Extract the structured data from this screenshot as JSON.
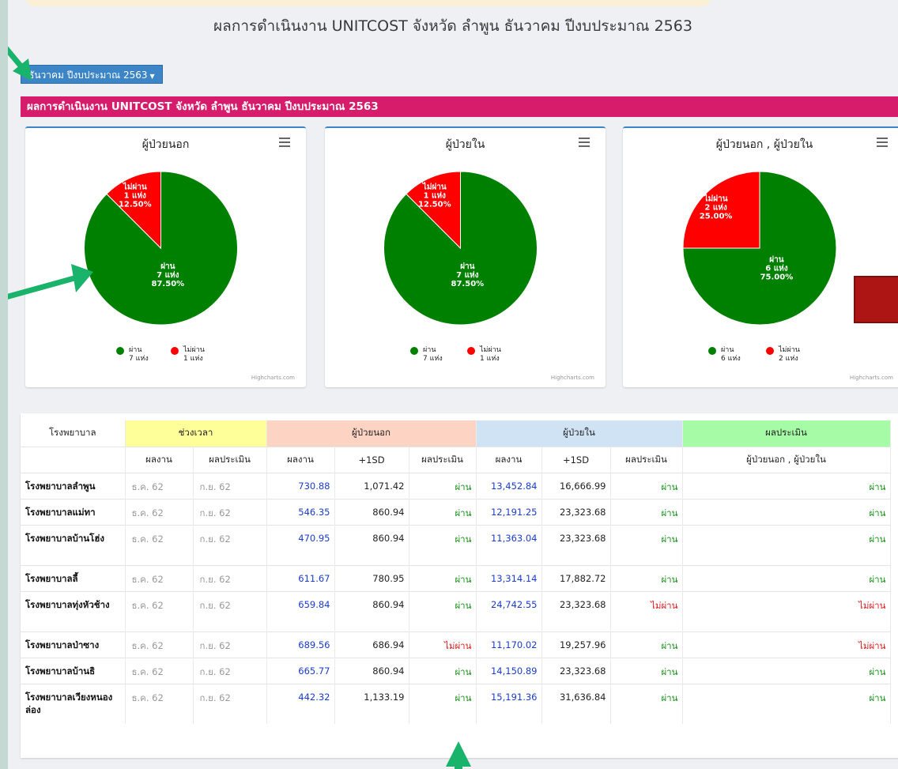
{
  "page": {
    "title": "ผลการดำเนินงาน UNITCOST จังหวัด ลำพูน ธันวาคม ปีงบประมาณ 2563",
    "period_button": "ธันวาคม ปีงบประมาณ 2563",
    "banner": "ผลการดำเนินงาน UNITCOST จังหวัด ลำพูน ธันวาคม ปีงบประมาณ 2563"
  },
  "colors": {
    "pass": "#008000",
    "fail": "#ff0000",
    "banner": "#d61c6b",
    "button": "#3c85c6",
    "arrow": "#19b36b"
  },
  "chart_data": [
    {
      "type": "pie",
      "title": "ผู้ป่วยนอก",
      "slices": [
        {
          "name": "ผ่าน",
          "value": 7,
          "percent": 87.5,
          "label_line1": "ผ่าน",
          "label_line2": "7 แห่ง",
          "label_line3": "87.50%",
          "legend_line2": "7 แห่ง"
        },
        {
          "name": "ไม่ผ่าน",
          "value": 1,
          "percent": 12.5,
          "label_line1": "ไม่ผ่าน",
          "label_line2": "1 แห่ง",
          "label_line3": "12.50%",
          "legend_line2": "1 แห่ง"
        }
      ],
      "credits": "Highcharts.com"
    },
    {
      "type": "pie",
      "title": "ผู้ป่วยใน",
      "slices": [
        {
          "name": "ผ่าน",
          "value": 7,
          "percent": 87.5,
          "label_line1": "ผ่าน",
          "label_line2": "7 แห่ง",
          "label_line3": "87.50%",
          "legend_line2": "7 แห่ง"
        },
        {
          "name": "ไม่ผ่าน",
          "value": 1,
          "percent": 12.5,
          "label_line1": "ไม่ผ่าน",
          "label_line2": "1 แห่ง",
          "label_line3": "12.50%",
          "legend_line2": "1 แห่ง"
        }
      ],
      "credits": "Highcharts.com"
    },
    {
      "type": "pie",
      "title": "ผู้ป่วยนอก , ผู้ป่วยใน",
      "slices": [
        {
          "name": "ผ่าน",
          "value": 6,
          "percent": 75.0,
          "label_line1": "ผ่าน",
          "label_line2": "6 แห่ง",
          "label_line3": "75.00%",
          "legend_line2": "6 แห่ง"
        },
        {
          "name": "ไม่ผ่าน",
          "value": 2,
          "percent": 25.0,
          "label_line1": "ไม่ผ่าน",
          "label_line2": "2 แห่ง",
          "label_line3": "25.00%",
          "legend_line2": "2 แห่ง"
        }
      ],
      "credits": "Highcharts.com"
    }
  ],
  "table": {
    "group_headers": {
      "hospital": "โรงพยาบาล",
      "period": "ช่วงเวลา",
      "opd": "ผู้ป่วยนอก",
      "ipd": "ผู้ป่วยใน",
      "eval": "ผลประเมิน"
    },
    "sub_headers": {
      "work": "ผลงาน",
      "assess": "ผลประเมิน",
      "work2": "ผลงาน",
      "sd": "+1SD",
      "assess2": "ผลประเมิน",
      "work3": "ผลงาน",
      "sd2": "+1SD",
      "assess3": "ผลประเมิน",
      "combined": "ผู้ป่วยนอก , ผู้ป่วยใน"
    },
    "rows": [
      {
        "hospital": "โรงพยาบาลลำพูน",
        "work_period": "ธ.ค. 62",
        "eval_period": "ก.ย. 62",
        "opd_work": "730.88",
        "opd_sd": "1,071.42",
        "opd_eval": "ผ่าน",
        "ipd_work": "13,452.84",
        "ipd_sd": "16,666.99",
        "ipd_eval": "ผ่าน",
        "combined": "ผ่าน"
      },
      {
        "hospital": "โรงพยาบาลแม่ทา",
        "work_period": "ธ.ค. 62",
        "eval_period": "ก.ย. 62",
        "opd_work": "546.35",
        "opd_sd": "860.94",
        "opd_eval": "ผ่าน",
        "ipd_work": "12,191.25",
        "ipd_sd": "23,323.68",
        "ipd_eval": "ผ่าน",
        "combined": "ผ่าน"
      },
      {
        "hospital": "โรงพยาบาลบ้านโฮ่ง",
        "work_period": "ธ.ค. 62",
        "eval_period": "ก.ย. 62",
        "opd_work": "470.95",
        "opd_sd": "860.94",
        "opd_eval": "ผ่าน",
        "ipd_work": "11,363.04",
        "ipd_sd": "23,323.68",
        "ipd_eval": "ผ่าน",
        "combined": "ผ่าน"
      },
      {
        "hospital": "โรงพยาบาลลี้",
        "work_period": "ธ.ค. 62",
        "eval_period": "ก.ย. 62",
        "opd_work": "611.67",
        "opd_sd": "780.95",
        "opd_eval": "ผ่าน",
        "ipd_work": "13,314.14",
        "ipd_sd": "17,882.72",
        "ipd_eval": "ผ่าน",
        "combined": "ผ่าน"
      },
      {
        "hospital": "โรงพยาบาลทุ่งหัวช้าง",
        "work_period": "ธ.ค. 62",
        "eval_period": "ก.ย. 62",
        "opd_work": "659.84",
        "opd_sd": "860.94",
        "opd_eval": "ผ่าน",
        "ipd_work": "24,742.55",
        "ipd_sd": "23,323.68",
        "ipd_eval": "ไม่ผ่าน",
        "combined": "ไม่ผ่าน"
      },
      {
        "hospital": "โรงพยาบาลป่าซาง",
        "work_period": "ธ.ค. 62",
        "eval_period": "ก.ย. 62",
        "opd_work": "689.56",
        "opd_sd": "686.94",
        "opd_eval": "ไม่ผ่าน",
        "ipd_work": "11,170.02",
        "ipd_sd": "19,257.96",
        "ipd_eval": "ผ่าน",
        "combined": "ไม่ผ่าน"
      },
      {
        "hospital": "โรงพยาบาลบ้านธิ",
        "work_period": "ธ.ค. 62",
        "eval_period": "ก.ย. 62",
        "opd_work": "665.77",
        "opd_sd": "860.94",
        "opd_eval": "ผ่าน",
        "ipd_work": "14,150.89",
        "ipd_sd": "23,323.68",
        "ipd_eval": "ผ่าน",
        "combined": "ผ่าน"
      },
      {
        "hospital": "โรงพยาบาลเวียงหนองล่อง",
        "work_period": "ธ.ค. 62",
        "eval_period": "ก.ย. 62",
        "opd_work": "442.32",
        "opd_sd": "1,133.19",
        "opd_eval": "ผ่าน",
        "ipd_work": "15,191.36",
        "ipd_sd": "31,636.84",
        "ipd_eval": "ผ่าน",
        "combined": "ผ่าน"
      }
    ]
  }
}
